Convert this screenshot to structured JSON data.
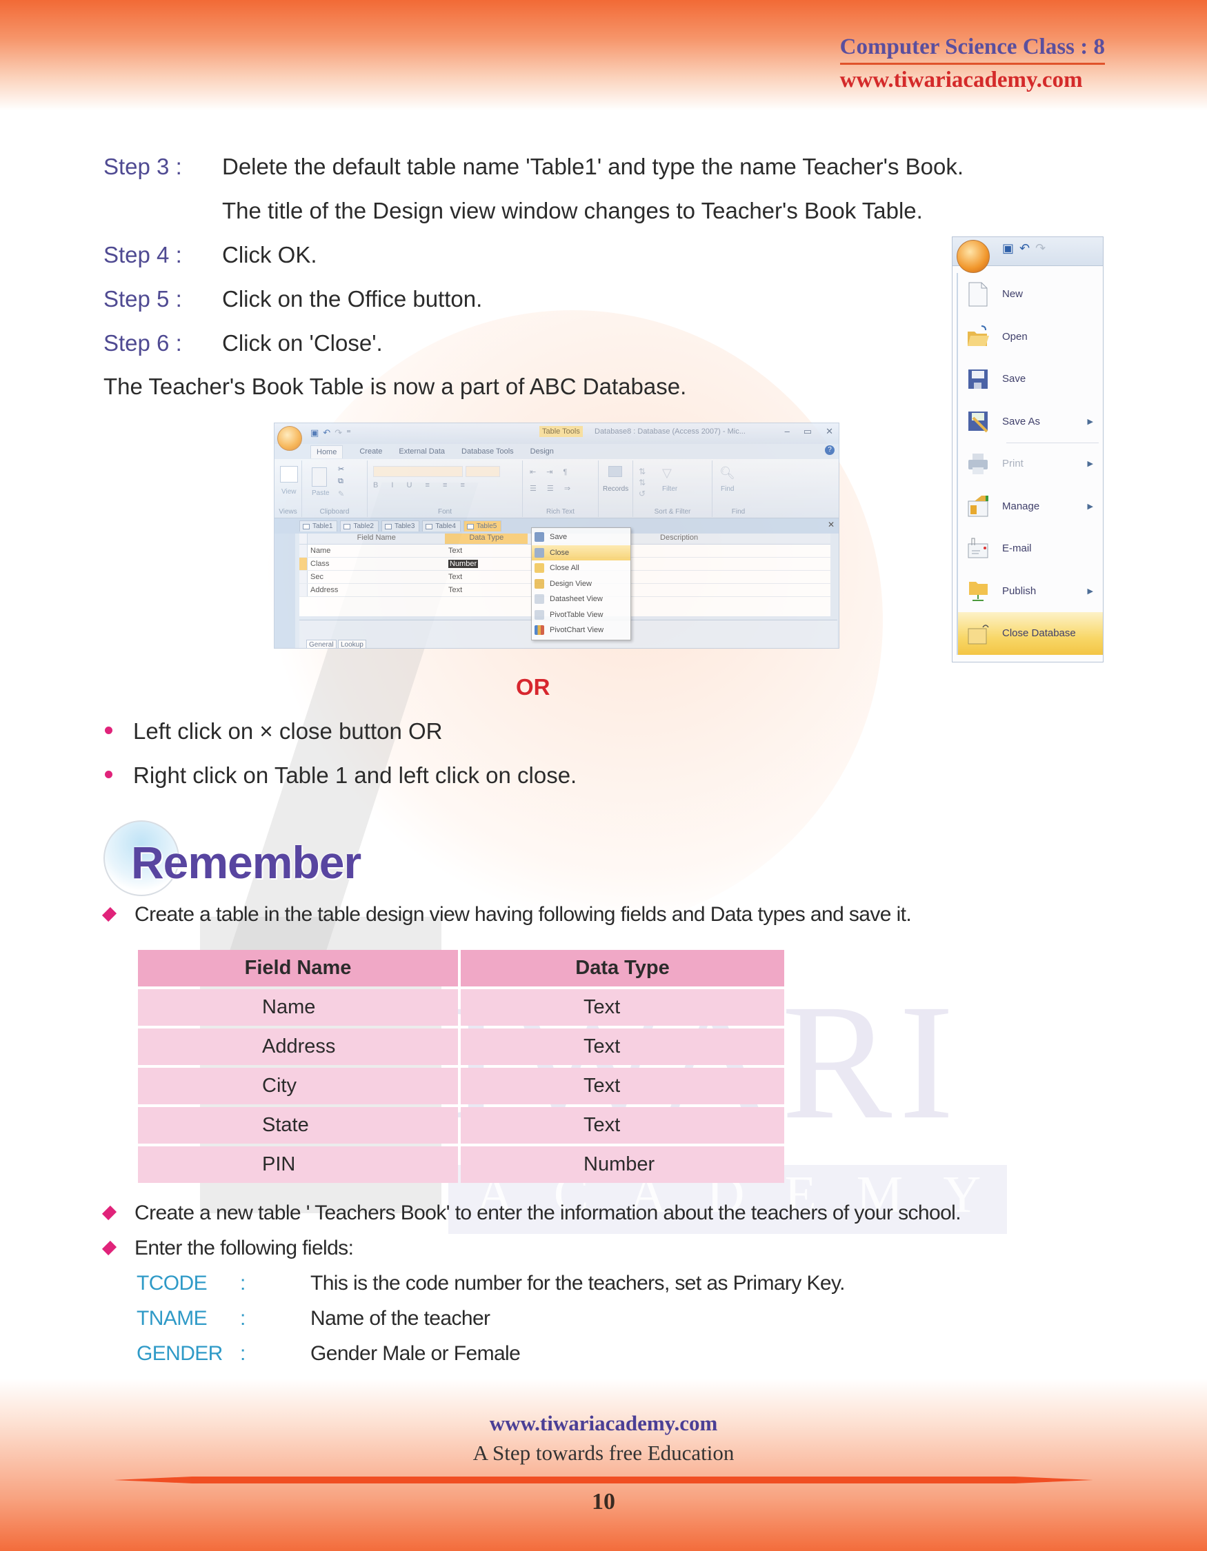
{
  "header": {
    "title": "Computer Science Class : 8",
    "url": "www.tiwariacademy.com"
  },
  "steps": [
    {
      "label": "Step 3 :",
      "lines": [
        "Delete the default table name 'Table1' and type the name Teacher's Book.",
        "The title of the Design view window changes to Teacher's Book Table."
      ]
    },
    {
      "label": "Step 4 :",
      "lines": [
        "Click OK."
      ]
    },
    {
      "label": "Step 5 :",
      "lines": [
        "Click on the Office button."
      ]
    },
    {
      "label": "Step 6 :",
      "lines": [
        "Click on 'Close'."
      ]
    }
  ],
  "summary": "The Teacher's Book Table is now a part of ABC Database.",
  "access_window": {
    "context_tab": "Table Tools",
    "window_title": "Database8 : Database (Access 2007) - Mic...",
    "ribbon_tabs": [
      "Home",
      "Create",
      "External Data",
      "Database Tools",
      "Design"
    ],
    "active_ribbon_tab": "Home",
    "ribbon_groups": [
      "Views",
      "Clipboard",
      "Font",
      "Rich Text",
      "",
      "Sort & Filter",
      "Find"
    ],
    "ribbon_buttons": {
      "view": "View",
      "paste": "Paste",
      "records": "Records",
      "filter": "Filter",
      "find": "Find"
    },
    "document_tabs": [
      "Table1",
      "Table2",
      "Table3",
      "Table4",
      "Table5"
    ],
    "active_document_tab": "Table5",
    "grid_headers": [
      "Field Name",
      "Data Type",
      "Description"
    ],
    "grid_rows": [
      {
        "field": "Name",
        "type": "Text"
      },
      {
        "field": "Class",
        "type": "Number"
      },
      {
        "field": "Sec",
        "type": "Text"
      },
      {
        "field": "Address",
        "type": "Text"
      }
    ],
    "property_tabs": [
      "General",
      "Lookup"
    ],
    "context_menu": [
      {
        "label": "Save",
        "icon": "save-icon"
      },
      {
        "label": "Close",
        "icon": "close-icon",
        "highlighted": true
      },
      {
        "label": "Close All",
        "icon": "close-all-icon"
      },
      {
        "label": "Design View",
        "icon": "design-view-icon"
      },
      {
        "label": "Datasheet View",
        "icon": "datasheet-view-icon"
      },
      {
        "label": "PivotTable View",
        "icon": "pivottable-view-icon"
      },
      {
        "label": "PivotChart View",
        "icon": "pivotchart-view-icon"
      }
    ]
  },
  "office_menu": {
    "items": [
      {
        "label": "New",
        "icon": "new-document-icon",
        "submenu": false
      },
      {
        "label": "Open",
        "icon": "open-folder-icon",
        "submenu": false
      },
      {
        "label": "Save",
        "icon": "save-icon",
        "submenu": false
      },
      {
        "label": "Save As",
        "icon": "save-as-icon",
        "submenu": true
      },
      {
        "label": "Print",
        "icon": "printer-icon",
        "submenu": true,
        "disabled": true
      },
      {
        "label": "Manage",
        "icon": "manage-icon",
        "submenu": true
      },
      {
        "label": "E-mail",
        "icon": "email-icon",
        "submenu": false
      },
      {
        "label": "Publish",
        "icon": "publish-icon",
        "submenu": true
      },
      {
        "label": "Close Database",
        "icon": "close-database-icon",
        "submenu": false,
        "highlighted": true
      }
    ]
  },
  "or_text": "OR",
  "bullets": [
    "Left click on × close button OR",
    "Right click on Table 1 and left click on close."
  ],
  "remember": {
    "title": "Remember",
    "intro": "Create a table in the table design view having following fields and Data types and save it.",
    "table": {
      "headers": [
        "Field Name",
        "Data Type"
      ],
      "rows": [
        [
          "Name",
          "Text"
        ],
        [
          "Address",
          "Text"
        ],
        [
          "City",
          "Text"
        ],
        [
          "State",
          "Text"
        ],
        [
          "PIN",
          "Number"
        ]
      ]
    },
    "task2": "Create a new table ' Teachers Book' to enter the information about the teachers of your school.",
    "task3": "Enter the following fields:",
    "fields": [
      {
        "key": "TCODE",
        "sep": ":",
        "desc": "This is the code number for the teachers, set as Primary Key."
      },
      {
        "key": "TNAME",
        "sep": ":",
        "desc": "Name of the teacher"
      },
      {
        "key": "GENDER",
        "sep": ":",
        "desc": "Gender Male or Female"
      }
    ]
  },
  "watermark": {
    "main": "IWARI",
    "sub": "ACADEMY"
  },
  "footer": {
    "url": "www.tiwariacademy.com",
    "tagline": "A Step towards free Education",
    "page_number": "10"
  },
  "colors": {
    "accent_purple": "#5a4f9e",
    "accent_red": "#d42a2a",
    "bullet_pink": "#e0237a",
    "field_key_blue": "#2f9ac7"
  }
}
